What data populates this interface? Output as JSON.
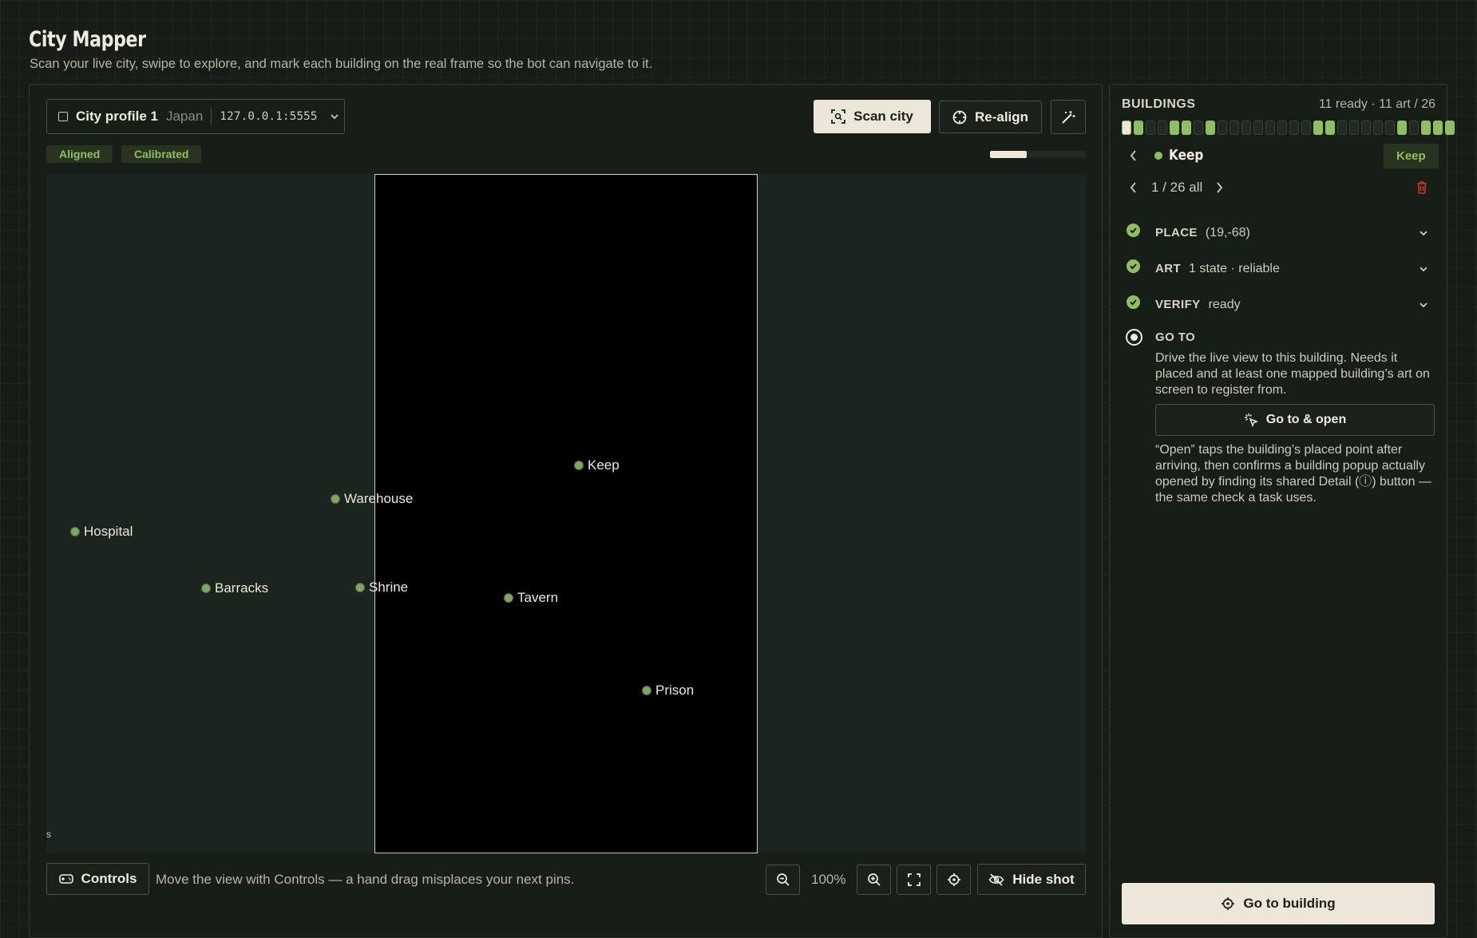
{
  "header": {
    "title": "City Mapper",
    "subtitle": "Scan your live city, swipe to explore, and mark each building on the real frame so the bot can navigate to it."
  },
  "toolbar": {
    "profile_name": "City profile 1",
    "profile_region": "Japan",
    "profile_address": "127.0.0.1:5555",
    "scan_label": "Scan city",
    "realign_label": "Re-align"
  },
  "status": {
    "badges": [
      "Aligned",
      "Calibrated"
    ],
    "progress": 0.38
  },
  "map": {
    "pins": [
      {
        "label": "Keep"
      },
      {
        "label": "Warehouse"
      },
      {
        "label": "Hospital"
      },
      {
        "label": "Barracks"
      },
      {
        "label": "Shrine"
      },
      {
        "label": "Tavern"
      },
      {
        "label": "Prison"
      }
    ],
    "edge_mark": "s"
  },
  "footer": {
    "controls_label": "Controls",
    "hint": "Move the view with Controls — a hand drag misplaces your next pins.",
    "zoom": "100%",
    "hide_shot_label": "Hide shot"
  },
  "sidebar": {
    "title": "BUILDINGS",
    "counts": "11 ready · 11 art / 26",
    "segments": [
      "current",
      "ready",
      "empty",
      "empty",
      "ready",
      "ready",
      "empty",
      "ready",
      "empty",
      "empty",
      "empty",
      "empty",
      "empty",
      "empty",
      "empty",
      "empty",
      "ready",
      "ready",
      "empty",
      "empty",
      "empty",
      "empty",
      "empty",
      "ready",
      "empty",
      "ready",
      "ready",
      "ready"
    ],
    "building_name": "Keep",
    "building_tag": "Keep",
    "pager": "1 / 26 all",
    "steps": [
      {
        "label": "PLACE",
        "value": "(19,-68)"
      },
      {
        "label": "ART",
        "value": "1 state · reliable"
      },
      {
        "label": "VERIFY",
        "value": "ready"
      }
    ],
    "goto": {
      "label": "GO TO",
      "description": "Drive the live view to this building. Needs it placed and at least one mapped building’s art on screen to register from.",
      "button_label": "Go to & open",
      "note": "“Open” taps the building’s placed point after arriving, then confirms a building popup actually opened by finding its shared Detail (ⓘ) button — the same check a task uses."
    },
    "primary_button": "Go to building"
  },
  "colors": {
    "accent": "#8fbe62",
    "background": "#171c17",
    "button_light": "#ece7da",
    "danger": "#d0342c"
  }
}
